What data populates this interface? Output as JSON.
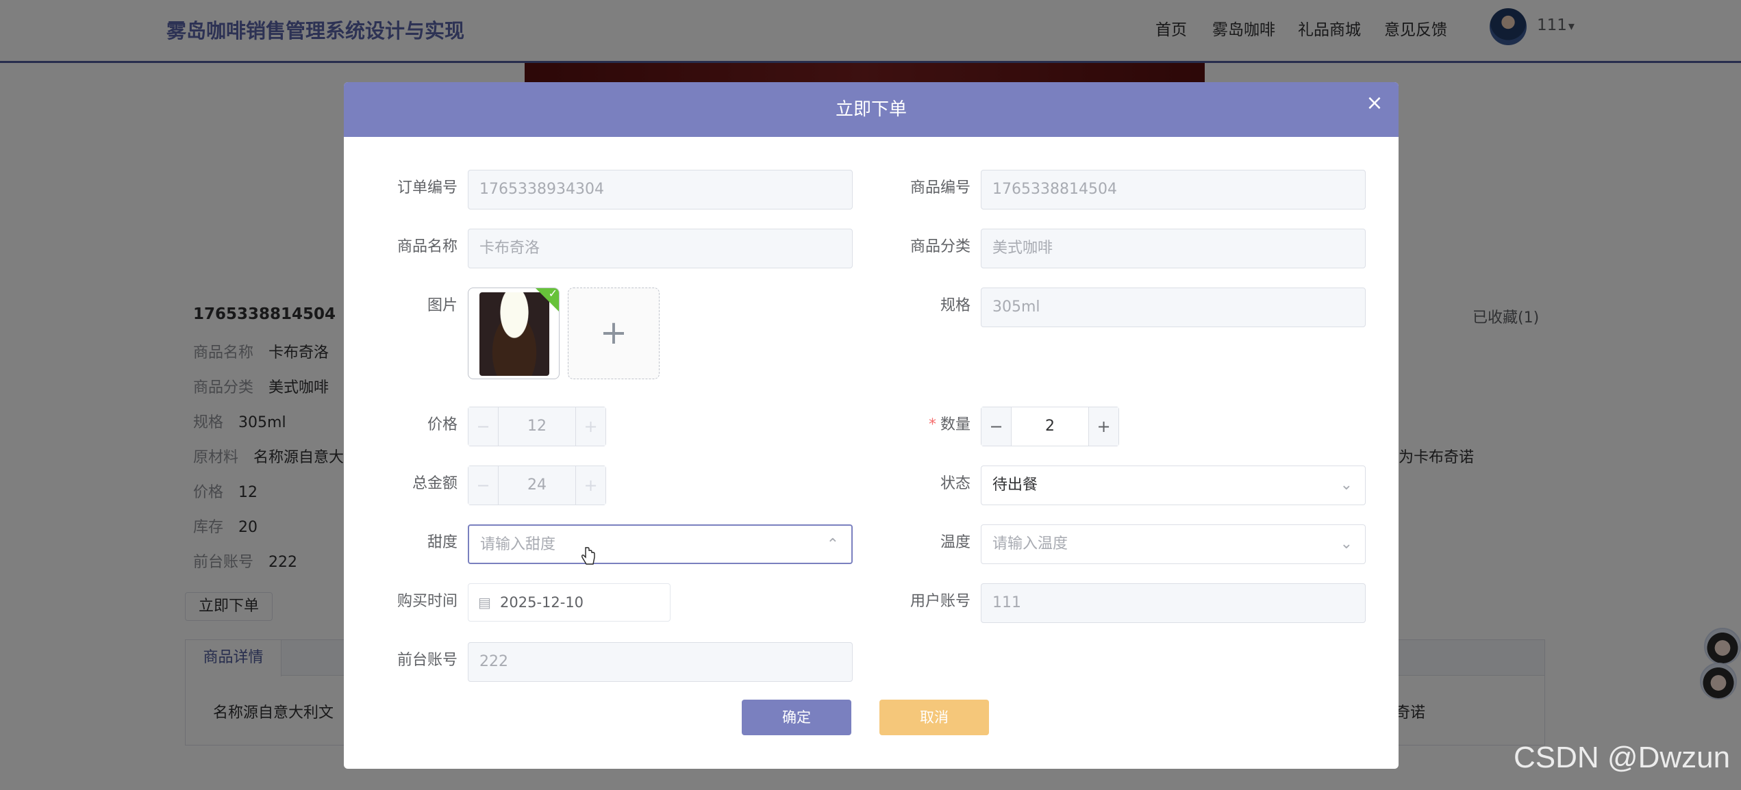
{
  "header": {
    "site_title": "雾岛咖啡销售管理系统设计与实现",
    "nav": [
      "首页",
      "雾岛咖啡",
      "礼品商城",
      "意见反馈"
    ],
    "user": "111"
  },
  "background": {
    "product_id": "1765338814504",
    "fields": [
      {
        "label": "商品名称",
        "value": "卡布奇洛"
      },
      {
        "label": "商品分类",
        "value": "美式咖啡"
      },
      {
        "label": "规格",
        "value": "305ml"
      },
      {
        "label": "原材料",
        "value": "名称源自意大"
      },
      {
        "label": "价格",
        "value": "12"
      },
      {
        "label": "库存",
        "value": "20"
      },
      {
        "label": "前台账号",
        "value": "222"
      }
    ],
    "order_button": "立即下单",
    "collect": "已收藏(1)",
    "right_snippet_1": "为卡布奇诺",
    "right_snippet_2": "奇诺",
    "tab_label": "商品详情",
    "tab_content": "名称源自意大利文"
  },
  "dialog": {
    "title": "立即下单",
    "close": "×",
    "order_no": {
      "label": "订单编号",
      "value": "1765338934304"
    },
    "product_no": {
      "label": "商品编号",
      "value": "1765338814504"
    },
    "product_name": {
      "label": "商品名称",
      "value": "卡布奇洛"
    },
    "category": {
      "label": "商品分类",
      "value": "美式咖啡"
    },
    "image": {
      "label": "图片",
      "add": "+"
    },
    "spec": {
      "label": "规格",
      "value": "305ml"
    },
    "price": {
      "label": "价格",
      "value": "12",
      "minus": "−",
      "plus": "+"
    },
    "quantity": {
      "label": "数量",
      "required_mark": "*",
      "value": "2",
      "minus": "−",
      "plus": "+"
    },
    "total": {
      "label": "总金额",
      "value": "24",
      "minus": "−",
      "plus": "+"
    },
    "status": {
      "label": "状态",
      "value": "待出餐"
    },
    "sweetness": {
      "label": "甜度",
      "placeholder": "请输入甜度"
    },
    "temperature": {
      "label": "温度",
      "placeholder": "请输入温度"
    },
    "purchase_time": {
      "label": "购买时间",
      "value": "2025-12-10"
    },
    "user_account": {
      "label": "用户账号",
      "value": "111"
    },
    "front_account": {
      "label": "前台账号",
      "value": "222"
    },
    "confirm": "确定",
    "cancel": "取消"
  },
  "watermark": "CSDN @Dwzun",
  "colors": {
    "dialog_header": "#7a80bf",
    "confirm_button": "#7a80bf",
    "cancel_button": "#f5c77a",
    "site_title": "#5b64a8"
  },
  "icons": [
    "close-icon",
    "plus-icon",
    "chevron-down-icon",
    "calendar-icon",
    "check-icon",
    "hand-cursor-icon"
  ]
}
